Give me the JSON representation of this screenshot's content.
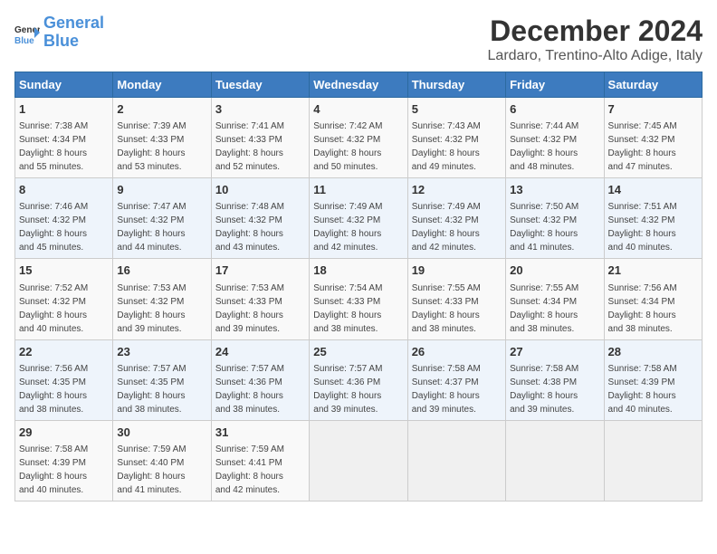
{
  "header": {
    "logo_line1": "General",
    "logo_line2": "Blue",
    "title": "December 2024",
    "subtitle": "Lardaro, Trentino-Alto Adige, Italy"
  },
  "days_of_week": [
    "Sunday",
    "Monday",
    "Tuesday",
    "Wednesday",
    "Thursday",
    "Friday",
    "Saturday"
  ],
  "weeks": [
    [
      {
        "day": "1",
        "info": "Sunrise: 7:38 AM\nSunset: 4:34 PM\nDaylight: 8 hours\nand 55 minutes."
      },
      {
        "day": "2",
        "info": "Sunrise: 7:39 AM\nSunset: 4:33 PM\nDaylight: 8 hours\nand 53 minutes."
      },
      {
        "day": "3",
        "info": "Sunrise: 7:41 AM\nSunset: 4:33 PM\nDaylight: 8 hours\nand 52 minutes."
      },
      {
        "day": "4",
        "info": "Sunrise: 7:42 AM\nSunset: 4:32 PM\nDaylight: 8 hours\nand 50 minutes."
      },
      {
        "day": "5",
        "info": "Sunrise: 7:43 AM\nSunset: 4:32 PM\nDaylight: 8 hours\nand 49 minutes."
      },
      {
        "day": "6",
        "info": "Sunrise: 7:44 AM\nSunset: 4:32 PM\nDaylight: 8 hours\nand 48 minutes."
      },
      {
        "day": "7",
        "info": "Sunrise: 7:45 AM\nSunset: 4:32 PM\nDaylight: 8 hours\nand 47 minutes."
      }
    ],
    [
      {
        "day": "8",
        "info": "Sunrise: 7:46 AM\nSunset: 4:32 PM\nDaylight: 8 hours\nand 45 minutes."
      },
      {
        "day": "9",
        "info": "Sunrise: 7:47 AM\nSunset: 4:32 PM\nDaylight: 8 hours\nand 44 minutes."
      },
      {
        "day": "10",
        "info": "Sunrise: 7:48 AM\nSunset: 4:32 PM\nDaylight: 8 hours\nand 43 minutes."
      },
      {
        "day": "11",
        "info": "Sunrise: 7:49 AM\nSunset: 4:32 PM\nDaylight: 8 hours\nand 42 minutes."
      },
      {
        "day": "12",
        "info": "Sunrise: 7:49 AM\nSunset: 4:32 PM\nDaylight: 8 hours\nand 42 minutes."
      },
      {
        "day": "13",
        "info": "Sunrise: 7:50 AM\nSunset: 4:32 PM\nDaylight: 8 hours\nand 41 minutes."
      },
      {
        "day": "14",
        "info": "Sunrise: 7:51 AM\nSunset: 4:32 PM\nDaylight: 8 hours\nand 40 minutes."
      }
    ],
    [
      {
        "day": "15",
        "info": "Sunrise: 7:52 AM\nSunset: 4:32 PM\nDaylight: 8 hours\nand 40 minutes."
      },
      {
        "day": "16",
        "info": "Sunrise: 7:53 AM\nSunset: 4:32 PM\nDaylight: 8 hours\nand 39 minutes."
      },
      {
        "day": "17",
        "info": "Sunrise: 7:53 AM\nSunset: 4:33 PM\nDaylight: 8 hours\nand 39 minutes."
      },
      {
        "day": "18",
        "info": "Sunrise: 7:54 AM\nSunset: 4:33 PM\nDaylight: 8 hours\nand 38 minutes."
      },
      {
        "day": "19",
        "info": "Sunrise: 7:55 AM\nSunset: 4:33 PM\nDaylight: 8 hours\nand 38 minutes."
      },
      {
        "day": "20",
        "info": "Sunrise: 7:55 AM\nSunset: 4:34 PM\nDaylight: 8 hours\nand 38 minutes."
      },
      {
        "day": "21",
        "info": "Sunrise: 7:56 AM\nSunset: 4:34 PM\nDaylight: 8 hours\nand 38 minutes."
      }
    ],
    [
      {
        "day": "22",
        "info": "Sunrise: 7:56 AM\nSunset: 4:35 PM\nDaylight: 8 hours\nand 38 minutes."
      },
      {
        "day": "23",
        "info": "Sunrise: 7:57 AM\nSunset: 4:35 PM\nDaylight: 8 hours\nand 38 minutes."
      },
      {
        "day": "24",
        "info": "Sunrise: 7:57 AM\nSunset: 4:36 PM\nDaylight: 8 hours\nand 38 minutes."
      },
      {
        "day": "25",
        "info": "Sunrise: 7:57 AM\nSunset: 4:36 PM\nDaylight: 8 hours\nand 39 minutes."
      },
      {
        "day": "26",
        "info": "Sunrise: 7:58 AM\nSunset: 4:37 PM\nDaylight: 8 hours\nand 39 minutes."
      },
      {
        "day": "27",
        "info": "Sunrise: 7:58 AM\nSunset: 4:38 PM\nDaylight: 8 hours\nand 39 minutes."
      },
      {
        "day": "28",
        "info": "Sunrise: 7:58 AM\nSunset: 4:39 PM\nDaylight: 8 hours\nand 40 minutes."
      }
    ],
    [
      {
        "day": "29",
        "info": "Sunrise: 7:58 AM\nSunset: 4:39 PM\nDaylight: 8 hours\nand 40 minutes."
      },
      {
        "day": "30",
        "info": "Sunrise: 7:59 AM\nSunset: 4:40 PM\nDaylight: 8 hours\nand 41 minutes."
      },
      {
        "day": "31",
        "info": "Sunrise: 7:59 AM\nSunset: 4:41 PM\nDaylight: 8 hours\nand 42 minutes."
      },
      {
        "day": "",
        "info": ""
      },
      {
        "day": "",
        "info": ""
      },
      {
        "day": "",
        "info": ""
      },
      {
        "day": "",
        "info": ""
      }
    ]
  ]
}
